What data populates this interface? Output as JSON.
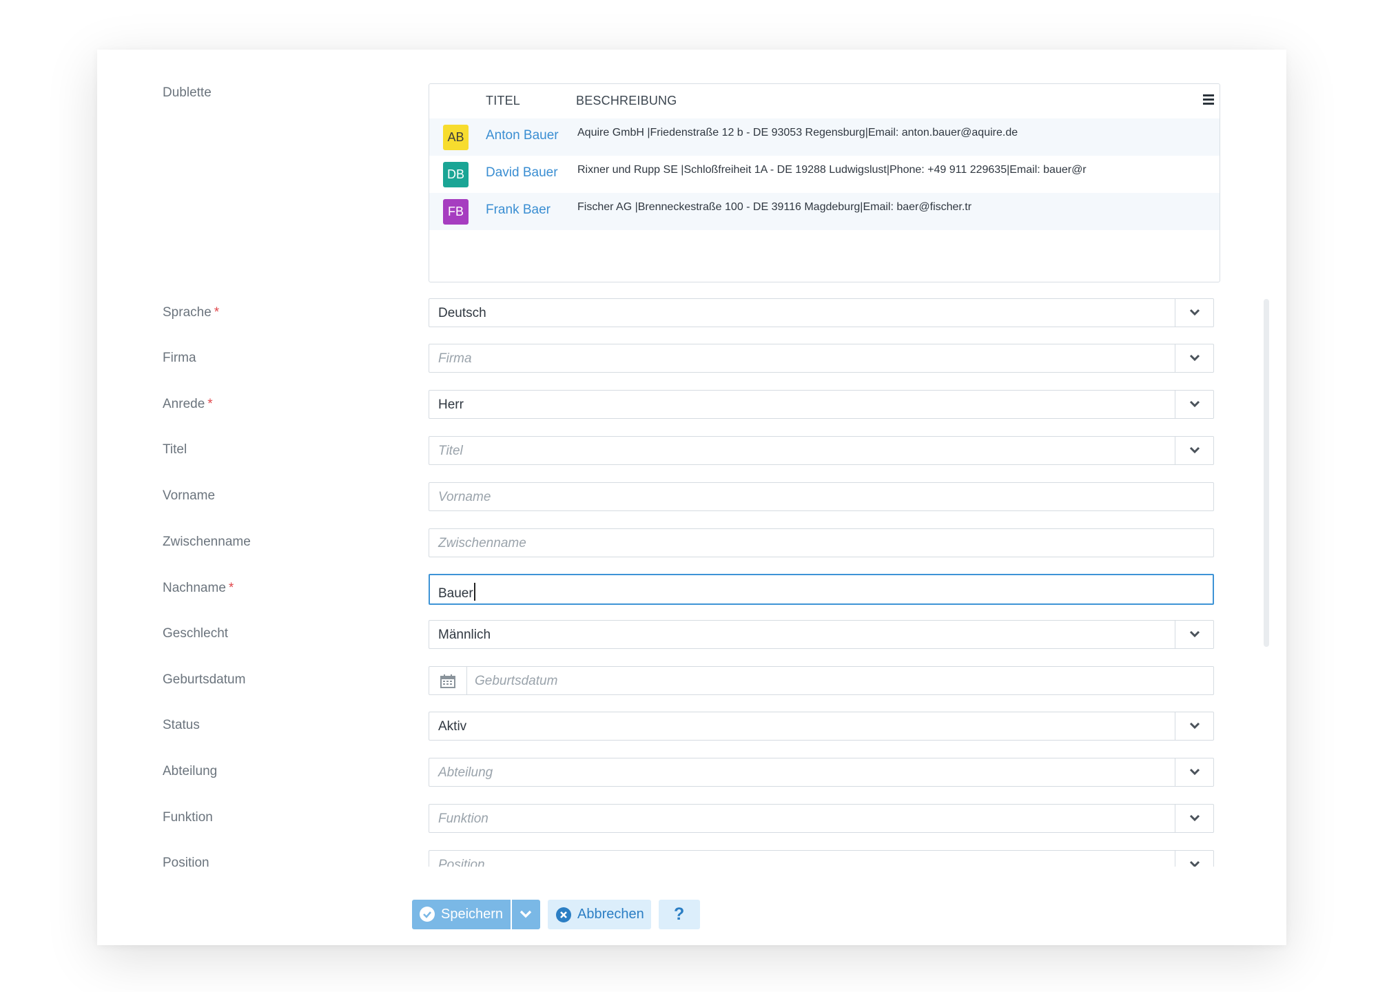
{
  "form": {
    "dublette": {
      "label": "Dublette",
      "columns": [
        "TITEL",
        "BESCHREIBUNG"
      ],
      "rows": [
        {
          "initials": "AB",
          "avatar_color": "#f7dc2e",
          "avatar_text_color": "#3c3c3c",
          "title": "Anton Bauer",
          "description": "Aquire GmbH |Friedenstraße 12 b - DE 93053 Regensburg|Email: anton.bauer@aquire.de"
        },
        {
          "initials": "DB",
          "avatar_color": "#1aa595",
          "avatar_text_color": "#ffffff",
          "title": "David Bauer",
          "description": "Rixner und Rupp SE |Schloßfreiheit 1A - DE 19288 Ludwigslust|Phone: +49 911 229635|Email: bauer@r"
        },
        {
          "initials": "FB",
          "avatar_color": "#a63dc0",
          "avatar_text_color": "#ffffff",
          "title": "Frank Baer",
          "description": "Fischer AG |Brenneckestraße 100 - DE 39116 Magdeburg|Email: baer@fischer.tr"
        }
      ]
    },
    "fields": {
      "sprache": {
        "label": "Sprache",
        "value": "Deutsch"
      },
      "firma": {
        "label": "Firma",
        "placeholder": "Firma"
      },
      "anrede": {
        "label": "Anrede",
        "value": "Herr"
      },
      "titel": {
        "label": "Titel",
        "placeholder": "Titel"
      },
      "vorname": {
        "label": "Vorname",
        "placeholder": "Vorname"
      },
      "zwischenname": {
        "label": "Zwischenname",
        "placeholder": "Zwischenname"
      },
      "nachname": {
        "label": "Nachname",
        "value": "Bauer"
      },
      "geschlecht": {
        "label": "Geschlecht",
        "value": "Männlich"
      },
      "geburtsdatum": {
        "label": "Geburtsdatum",
        "placeholder": "Geburtsdatum"
      },
      "status": {
        "label": "Status",
        "value": "Aktiv"
      },
      "abteilung": {
        "label": "Abteilung",
        "placeholder": "Abteilung"
      },
      "funktion": {
        "label": "Funktion",
        "placeholder": "Funktion"
      },
      "position": {
        "label": "Position",
        "placeholder": "Position"
      }
    },
    "required_marker": "*"
  },
  "actions": {
    "save": "Speichern",
    "cancel": "Abbrechen",
    "help": "?"
  },
  "colors": {
    "link": "#3a8ed2",
    "focus_border": "#3d93d6",
    "required": "#e0474c",
    "save_button": "#7ab8e6",
    "secondary_button": "#dceefb"
  }
}
